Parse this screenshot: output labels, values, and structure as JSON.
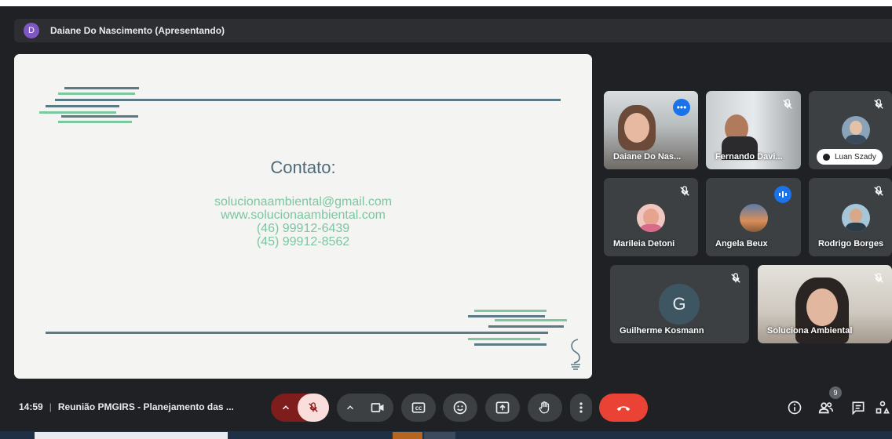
{
  "presenter": {
    "initial": "D",
    "label": "Daiane Do Nascimento (Apresentando)"
  },
  "slide": {
    "title": "Contato:",
    "email": "solucionaambiental@gmail.com",
    "website": "www.solucionaambiental.com",
    "phone1": "(46) 99912-6439",
    "phone2": "(45) 99912-8562"
  },
  "participants": [
    {
      "name": "Daiane Do Nas..."
    },
    {
      "name": "Fernando Davi..."
    },
    {
      "name": "Luan Szady"
    },
    {
      "name": "Marileia Detoni"
    },
    {
      "name": "Angela Beux"
    },
    {
      "name": "Rodrigo Borges"
    },
    {
      "name": "Guilherme Kosmann",
      "initial": "G"
    },
    {
      "name": "Soluciona Ambiental"
    }
  ],
  "meeting": {
    "time": "14:59",
    "title": "Reunião PMGIRS - Planejamento das ...",
    "participant_count": "9"
  },
  "colors": {
    "accent": "#1a73e8",
    "end_call": "#ea4335",
    "mic_off_bg": "#f9dedc",
    "slide_green": "#7cc6a0",
    "slide_gray": "#5b7a86"
  },
  "icons": [
    "mic-off-icon",
    "camera-icon",
    "captions-icon",
    "emoji-icon",
    "present-icon",
    "raise-hand-icon",
    "more-vert-icon",
    "end-call-icon",
    "info-icon",
    "people-icon",
    "chat-icon",
    "activities-icon"
  ]
}
